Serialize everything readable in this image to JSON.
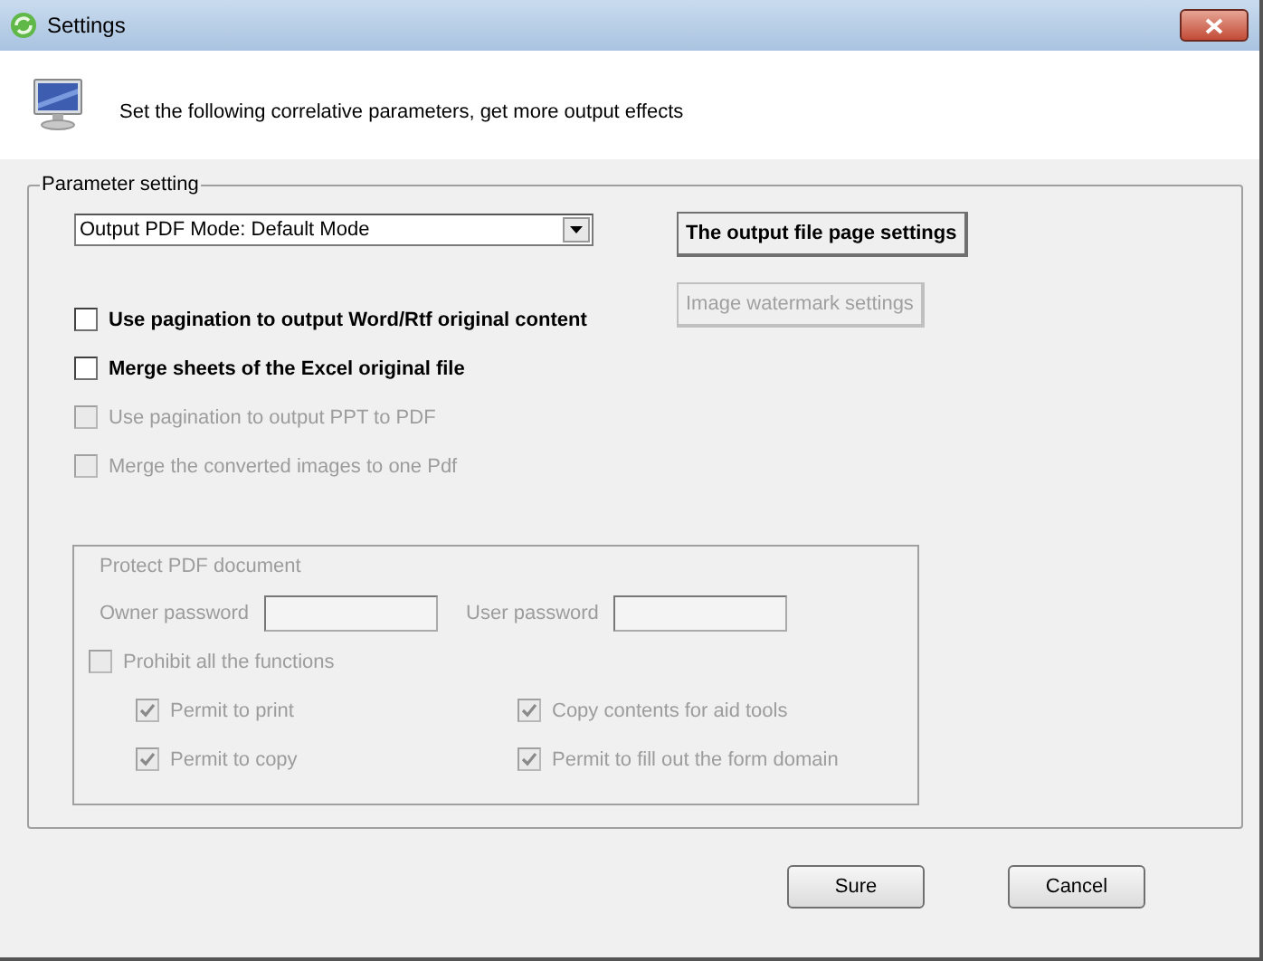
{
  "window": {
    "title": "Settings"
  },
  "header": {
    "text": "Set the following correlative parameters, get more output effects"
  },
  "parameter_group": {
    "title": "Parameter setting",
    "mode_select": {
      "value": "Output PDF Mode: Default Mode"
    },
    "side_buttons": [
      {
        "label": "The output file page settings",
        "disabled": false
      },
      {
        "label": "Image watermark settings",
        "disabled": true
      }
    ],
    "options": [
      {
        "label": "Use pagination to output Word/Rtf original content",
        "checked": false,
        "disabled": false
      },
      {
        "label": "Merge sheets of the Excel original file",
        "checked": false,
        "disabled": false
      },
      {
        "label": "Use pagination to output PPT to PDF",
        "checked": false,
        "disabled": true
      },
      {
        "label": "Merge the converted images to one Pdf",
        "checked": false,
        "disabled": true
      }
    ],
    "protect_group": {
      "title": "Protect PDF document",
      "disabled": true,
      "owner_password": {
        "label": "Owner password"
      },
      "user_password": {
        "label": "User password"
      },
      "prohibit": {
        "label": "Prohibit all the functions",
        "checked": false
      },
      "permissions": [
        {
          "label": "Permit to print",
          "checked": true
        },
        {
          "label": "Copy contents for aid tools",
          "checked": true
        },
        {
          "label": "Permit to copy",
          "checked": true
        },
        {
          "label": "Permit to fill out the form domain",
          "checked": true
        }
      ]
    }
  },
  "buttons": [
    {
      "label": "Sure"
    },
    {
      "label": "Cancel"
    }
  ]
}
